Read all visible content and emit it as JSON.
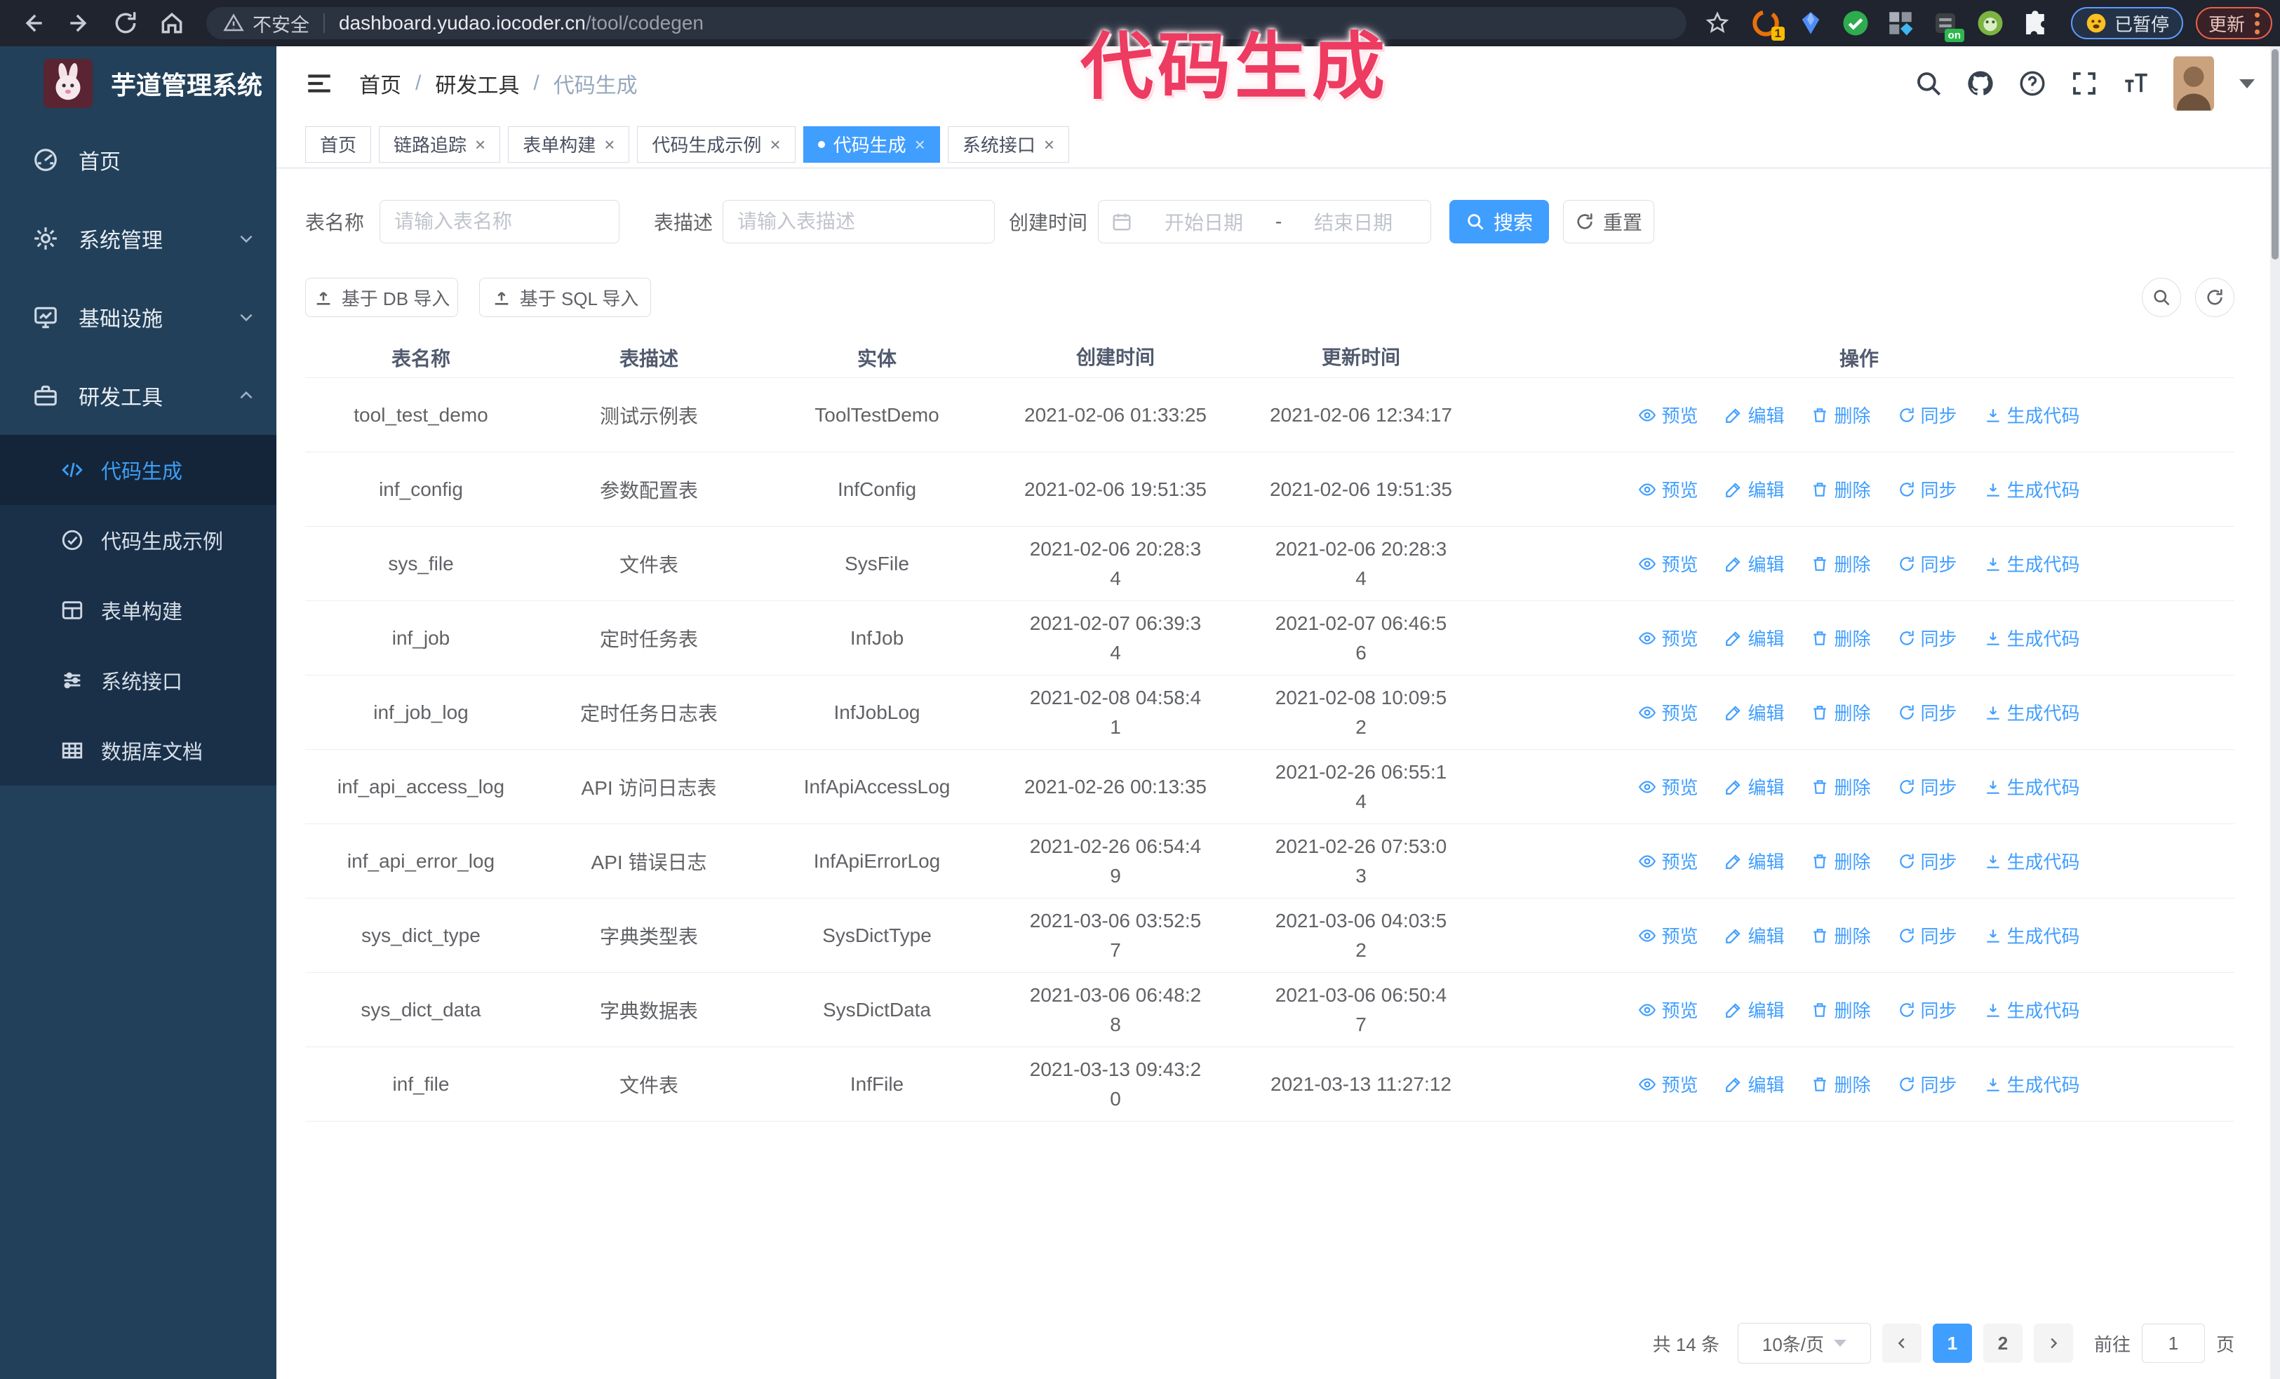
{
  "browser": {
    "security_label": "不安全",
    "url_host": "dashboard.yudao.iocoder.cn",
    "url_path": "/tool/codegen",
    "ext_badge_count": "1",
    "ext_on_badge": "on",
    "paused_label": "已暂停",
    "update_label": "更新"
  },
  "annotation": {
    "text": "代码生成"
  },
  "sidebar": {
    "logo_title": "芋道管理系统",
    "items": [
      {
        "label": "首页"
      },
      {
        "label": "系统管理"
      },
      {
        "label": "基础设施"
      },
      {
        "label": "研发工具"
      }
    ],
    "submenu": [
      {
        "label": "代码生成"
      },
      {
        "label": "代码生成示例"
      },
      {
        "label": "表单构建"
      },
      {
        "label": "系统接口"
      },
      {
        "label": "数据库文档"
      }
    ]
  },
  "header": {
    "breadcrumb": [
      "首页",
      "研发工具",
      "代码生成"
    ],
    "separator": "/"
  },
  "tabs": [
    {
      "label": "首页"
    },
    {
      "label": "链路追踪"
    },
    {
      "label": "表单构建"
    },
    {
      "label": "代码生成示例"
    },
    {
      "label": "代码生成"
    },
    {
      "label": "系统接口"
    }
  ],
  "filters": {
    "table_name_label": "表名称",
    "table_name_placeholder": "请输入表名称",
    "table_desc_label": "表描述",
    "table_desc_placeholder": "请输入表描述",
    "create_time_label": "创建时间",
    "date_start_placeholder": "开始日期",
    "date_separator": "-",
    "date_end_placeholder": "结束日期",
    "search_label": "搜索",
    "reset_label": "重置"
  },
  "toolbar": {
    "import_db_label": "基于 DB 导入",
    "import_sql_label": "基于 SQL 导入"
  },
  "table": {
    "columns": [
      "表名称",
      "表描述",
      "实体",
      "创建时间",
      "更新时间",
      "操作"
    ],
    "actions": [
      "预览",
      "编辑",
      "删除",
      "同步",
      "生成代码"
    ],
    "rows": [
      {
        "name": "tool_test_demo",
        "desc": "测试示例表",
        "entity": "ToolTestDemo",
        "created": "2021-02-06 01:33:25",
        "updated": "2021-02-06 12:34:17"
      },
      {
        "name": "inf_config",
        "desc": "参数配置表",
        "entity": "InfConfig",
        "created": "2021-02-06 19:51:35",
        "updated": "2021-02-06 19:51:35"
      },
      {
        "name": "sys_file",
        "desc": "文件表",
        "entity": "SysFile",
        "created": "2021-02-06 20:28:3\n4",
        "updated": "2021-02-06 20:28:3\n4"
      },
      {
        "name": "inf_job",
        "desc": "定时任务表",
        "entity": "InfJob",
        "created": "2021-02-07 06:39:3\n4",
        "updated": "2021-02-07 06:46:5\n6"
      },
      {
        "name": "inf_job_log",
        "desc": "定时任务日志表",
        "entity": "InfJobLog",
        "created": "2021-02-08 04:58:4\n1",
        "updated": "2021-02-08 10:09:5\n2"
      },
      {
        "name": "inf_api_access_log",
        "desc": "API 访问日志表",
        "entity": "InfApiAccessLog",
        "created": "2021-02-26 00:13:35",
        "updated": "2021-02-26 06:55:1\n4"
      },
      {
        "name": "inf_api_error_log",
        "desc": "API 错误日志",
        "entity": "InfApiErrorLog",
        "created": "2021-02-26 06:54:4\n9",
        "updated": "2021-02-26 07:53:0\n3"
      },
      {
        "name": "sys_dict_type",
        "desc": "字典类型表",
        "entity": "SysDictType",
        "created": "2021-03-06 03:52:5\n7",
        "updated": "2021-03-06 04:03:5\n2"
      },
      {
        "name": "sys_dict_data",
        "desc": "字典数据表",
        "entity": "SysDictData",
        "created": "2021-03-06 06:48:2\n8",
        "updated": "2021-03-06 06:50:4\n7"
      },
      {
        "name": "inf_file",
        "desc": "文件表",
        "entity": "InfFile",
        "created": "2021-03-13 09:43:2\n0",
        "updated": "2021-03-13 11:27:12"
      }
    ]
  },
  "pagination": {
    "total_label": "共 14 条",
    "page_size": "10条/页",
    "pages": [
      "1",
      "2"
    ],
    "goto_label": "前往",
    "goto_value": "1",
    "page_unit": "页"
  },
  "colors": {
    "accent": "#409EFF",
    "annotation_pink": "#ee3b61",
    "sidebar_bg": "#224059",
    "submenu_bg": "#1a3049",
    "chrome_bg": "#1f242e"
  }
}
